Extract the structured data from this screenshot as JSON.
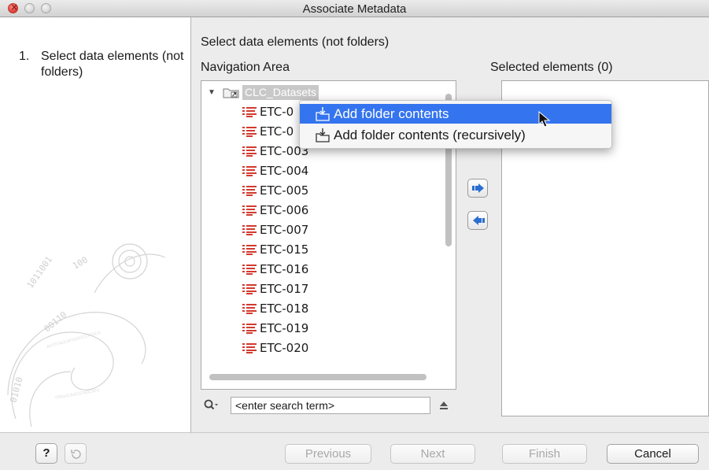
{
  "window": {
    "title": "Associate Metadata"
  },
  "steps": {
    "items": [
      {
        "number": "1.",
        "label": "Select data elements (not folders)"
      }
    ]
  },
  "main": {
    "heading": "Select data elements (not folders)",
    "navigation_label": "Navigation Area",
    "selected_label": "Selected elements (0)",
    "tree": {
      "root": "CLC_Datasets",
      "items": [
        "ETC-0",
        "ETC-0",
        "ETC-003",
        "ETC-004",
        "ETC-005",
        "ETC-006",
        "ETC-007",
        "ETC-015",
        "ETC-016",
        "ETC-017",
        "ETC-018",
        "ETC-019",
        "ETC-020"
      ]
    },
    "search": {
      "value": "<enter search term>"
    }
  },
  "context_menu": {
    "items": [
      {
        "label": "Add folder contents",
        "highlighted": true
      },
      {
        "label": "Add folder contents (recursively)",
        "highlighted": false
      }
    ]
  },
  "footer": {
    "help_label": "?",
    "previous_label": "Previous",
    "next_label": "Next",
    "finish_label": "Finish",
    "cancel_label": "Cancel"
  },
  "colors": {
    "menu_highlight": "#3474ef",
    "arrow_blue": "#2a6fd0",
    "sequence_red": "#d23a2e"
  }
}
